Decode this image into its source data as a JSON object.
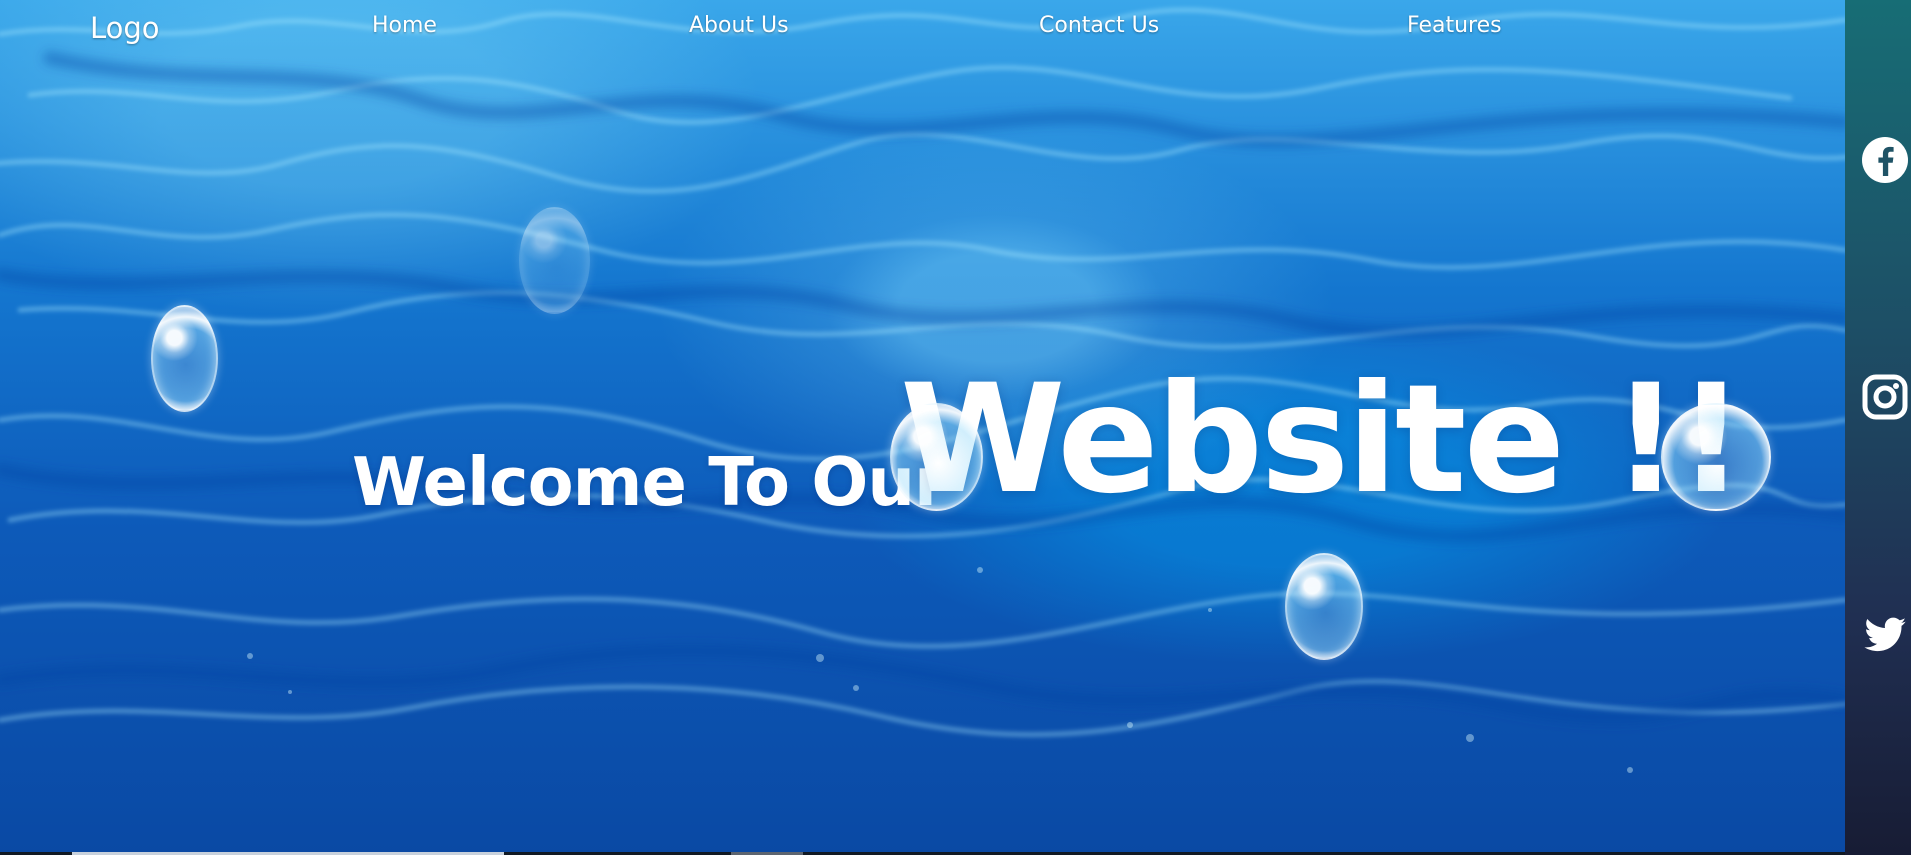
{
  "nav": {
    "logo": "Logo",
    "items": [
      {
        "label": "Home"
      },
      {
        "label": "About Us"
      },
      {
        "label": "Contact Us"
      },
      {
        "label": "Features"
      }
    ]
  },
  "hero": {
    "welcome": "Welcome To Our",
    "website": "Website !!"
  },
  "social": {
    "icons": [
      "facebook-icon",
      "instagram-icon",
      "twitter-icon"
    ]
  },
  "colors": {
    "text": "#ffffff",
    "sidebar_top": "#176d75",
    "sidebar_bottom": "#171c34",
    "water_blue": "#0d5ab9"
  }
}
